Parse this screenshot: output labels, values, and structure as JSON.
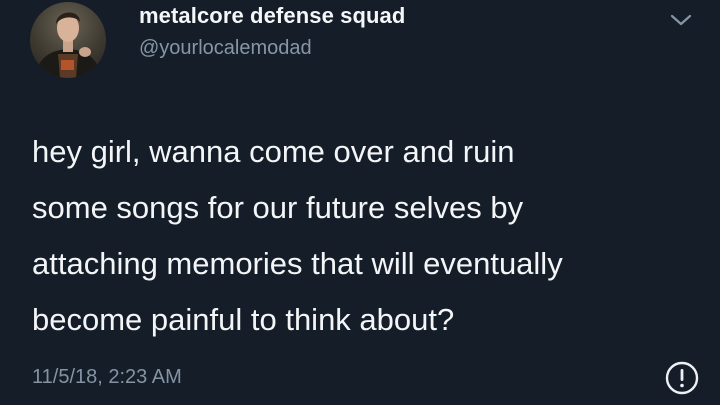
{
  "tweet": {
    "display_name": "metalcore defense squad",
    "handle": "@yourlocalemodad",
    "text_lines": [
      "hey girl, wanna come over and ruin",
      "some songs for our future selves by",
      "attaching memories that will eventually",
      "become painful to think about?"
    ],
    "timestamp": "11/5/18, 2:23 AM"
  },
  "icons": {
    "menu": "chevron-down-icon",
    "info": "info-icon"
  },
  "colors": {
    "background": "#151d29",
    "primary_text": "#f3f5f7",
    "secondary_text": "#8796a6"
  }
}
